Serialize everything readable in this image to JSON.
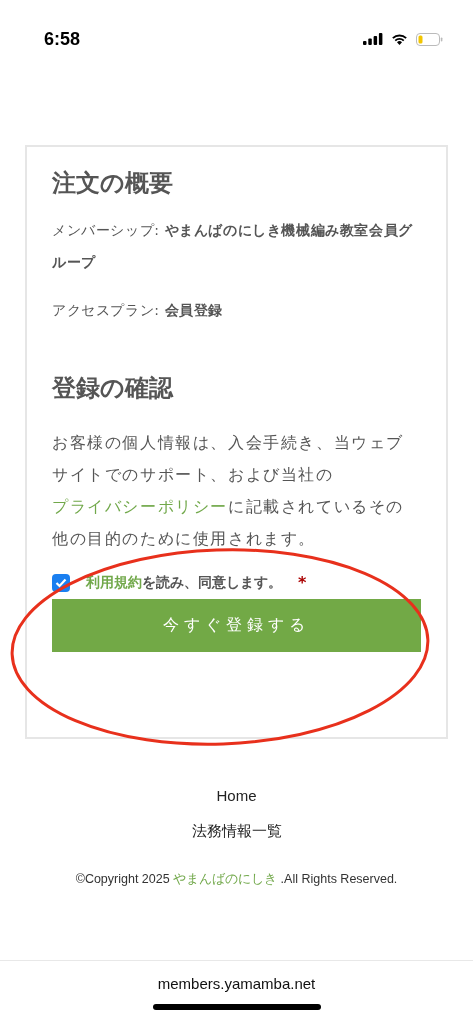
{
  "status_bar": {
    "time": "6:58"
  },
  "order_summary": {
    "title": "注文の概要",
    "lines": [
      {
        "label": "メンバーシップ:",
        "value": "やまんばのにしき機械編み教室会員グループ"
      },
      {
        "label": "アクセスプラン:",
        "value": "会員登録"
      }
    ]
  },
  "confirmation": {
    "title": "登録の確認",
    "privacy_text": {
      "before": "お客様の個人情報は、入会手続き、当ウェブサイトでのサポート、および当社の",
      "link": "プライバシーポリシー",
      "after": "に記載されているその他の目的のために使用されます。"
    },
    "terms": {
      "checked": true,
      "link_text": "利用規約",
      "text": "を読み、同意します。",
      "required_mark": "*"
    },
    "submit_button": "今すぐ登録する"
  },
  "annotation": {
    "kind": "ellipse",
    "color": "#e8301c"
  },
  "footer": {
    "links": [
      "Home",
      "法務情報一覧"
    ],
    "copyright_before": "©Copyright 2025",
    "copyright_link": "やまんばのにしき",
    "copyright_after": ".All Rights Reserved."
  },
  "address_bar": {
    "url": "members.yamamba.net"
  }
}
